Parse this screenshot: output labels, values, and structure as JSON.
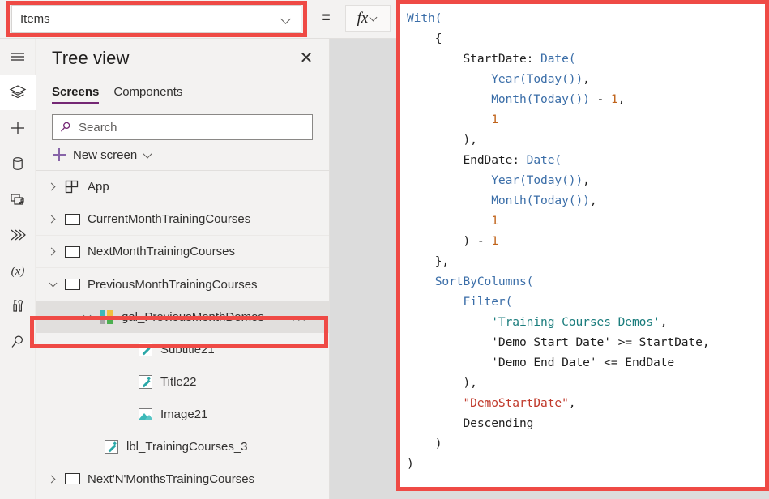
{
  "formula_bar": {
    "property_value": "Items",
    "property_dropdown_icon": "chevron-down-icon",
    "equals_sign": "=",
    "fx_label": "fx",
    "fx_dropdown_icon": "chevron-down-icon"
  },
  "rail": {
    "items": [
      {
        "name": "menu-icon",
        "title": "Menu",
        "selected": false
      },
      {
        "name": "tree-view-icon",
        "title": "Tree view",
        "selected": true
      },
      {
        "name": "insert-icon",
        "title": "Insert",
        "selected": false
      },
      {
        "name": "data-icon",
        "title": "Data",
        "selected": false
      },
      {
        "name": "media-icon",
        "title": "Media",
        "selected": false
      },
      {
        "name": "power-automate-icon",
        "title": "Power Automate",
        "selected": false
      },
      {
        "name": "variables-icon",
        "title": "Variables",
        "selected": false
      },
      {
        "name": "advanced-tools-icon",
        "title": "Advanced tools",
        "selected": false
      },
      {
        "name": "search-icon",
        "title": "Search",
        "selected": false
      }
    ]
  },
  "tree_view": {
    "title": "Tree view",
    "close_icon": "close-icon",
    "tabs": [
      {
        "label": "Screens",
        "active": true
      },
      {
        "label": "Components",
        "active": false
      }
    ],
    "search": {
      "placeholder": "Search",
      "value": "",
      "icon": "search-icon"
    },
    "new_screen": {
      "label": "New screen",
      "plus_icon": "plus-icon",
      "chevron_icon": "chevron-down-icon"
    },
    "rows": [
      {
        "label": "App",
        "icon": "app-icon",
        "indent": 0,
        "caret": "collapsed",
        "selected": false
      },
      {
        "label": "CurrentMonthTrainingCourses",
        "icon": "screen-icon",
        "indent": 0,
        "caret": "collapsed",
        "selected": false
      },
      {
        "label": "NextMonthTrainingCourses",
        "icon": "screen-icon",
        "indent": 0,
        "caret": "collapsed",
        "selected": false
      },
      {
        "label": "PreviousMonthTrainingCourses",
        "icon": "screen-icon",
        "indent": 0,
        "caret": "expanded",
        "selected": false
      },
      {
        "label": "gal_PreviousMonthDemos",
        "icon": "gallery-icon",
        "indent": 1,
        "caret": "expanded",
        "selected": true,
        "overflow": "..."
      },
      {
        "label": "Subtitle21",
        "icon": "label-icon",
        "indent": 2,
        "caret": "none",
        "selected": false
      },
      {
        "label": "Title22",
        "icon": "label-icon",
        "indent": 2,
        "caret": "none",
        "selected": false
      },
      {
        "label": "Image21",
        "icon": "image-icon",
        "indent": 2,
        "caret": "none",
        "selected": false
      },
      {
        "label": "lbl_TrainingCourses_3",
        "icon": "label-icon",
        "indent": 1,
        "caret": "none",
        "selected": false
      },
      {
        "label": "Next'N'MonthsTrainingCourses",
        "icon": "screen-icon",
        "indent": 0,
        "caret": "collapsed",
        "selected": false
      }
    ]
  },
  "code_editor": {
    "language": "Power Fx",
    "lines": [
      [
        {
          "t": "With(",
          "c": "fn"
        }
      ],
      [
        {
          "t": "    {",
          "c": "plain"
        }
      ],
      [
        {
          "t": "        StartDate: ",
          "c": "plain"
        },
        {
          "t": "Date(",
          "c": "fn"
        }
      ],
      [
        {
          "t": "            ",
          "c": "plain"
        },
        {
          "t": "Year(Today())",
          "c": "fn"
        },
        {
          "t": ",",
          "c": "plain"
        }
      ],
      [
        {
          "t": "            ",
          "c": "plain"
        },
        {
          "t": "Month(Today())",
          "c": "fn"
        },
        {
          "t": " - ",
          "c": "plain"
        },
        {
          "t": "1",
          "c": "num"
        },
        {
          "t": ",",
          "c": "plain"
        }
      ],
      [
        {
          "t": "            ",
          "c": "plain"
        },
        {
          "t": "1",
          "c": "num"
        }
      ],
      [
        {
          "t": "        ),",
          "c": "plain"
        }
      ],
      [
        {
          "t": "        EndDate: ",
          "c": "plain"
        },
        {
          "t": "Date(",
          "c": "fn"
        }
      ],
      [
        {
          "t": "            ",
          "c": "plain"
        },
        {
          "t": "Year(Today())",
          "c": "fn"
        },
        {
          "t": ",",
          "c": "plain"
        }
      ],
      [
        {
          "t": "            ",
          "c": "plain"
        },
        {
          "t": "Month(Today())",
          "c": "fn"
        },
        {
          "t": ",",
          "c": "plain"
        }
      ],
      [
        {
          "t": "            ",
          "c": "plain"
        },
        {
          "t": "1",
          "c": "num"
        }
      ],
      [
        {
          "t": "        ) - ",
          "c": "plain"
        },
        {
          "t": "1",
          "c": "num"
        }
      ],
      [
        {
          "t": "    },",
          "c": "plain"
        }
      ],
      [
        {
          "t": "    ",
          "c": "plain"
        },
        {
          "t": "SortByColumns(",
          "c": "fn"
        }
      ],
      [
        {
          "t": "        ",
          "c": "plain"
        },
        {
          "t": "Filter(",
          "c": "fn"
        }
      ],
      [
        {
          "t": "            ",
          "c": "plain"
        },
        {
          "t": "'Training Courses Demos'",
          "c": "tbl"
        },
        {
          "t": ",",
          "c": "plain"
        }
      ],
      [
        {
          "t": "            'Demo Start Date' >= StartDate,",
          "c": "plain"
        }
      ],
      [
        {
          "t": "            'Demo End Date' <= EndDate",
          "c": "plain"
        }
      ],
      [
        {
          "t": "        ),",
          "c": "plain"
        }
      ],
      [
        {
          "t": "        ",
          "c": "plain"
        },
        {
          "t": "\"DemoStartDate\"",
          "c": "str"
        },
        {
          "t": ",",
          "c": "plain"
        }
      ],
      [
        {
          "t": "        Descending",
          "c": "plain"
        }
      ],
      [
        {
          "t": "    )",
          "c": "plain"
        }
      ],
      [
        {
          "t": ")",
          "c": "plain"
        }
      ]
    ]
  },
  "annotations": {
    "highlight_color": "#ef4a45",
    "boxes": [
      {
        "name": "property-dropdown-highlight"
      },
      {
        "name": "gallery-node-highlight"
      },
      {
        "name": "formula-code-highlight"
      }
    ]
  },
  "colors": {
    "accent_purple": "#742774",
    "panel_background": "#f3f2f1",
    "selected_row": "#e1dfdd",
    "gallery_icon_tiles": [
      "#3cb8b8",
      "#f0c040",
      "#a6a6a6",
      "#4caf50"
    ],
    "code_function": "#3b6ea8",
    "code_number": "#c0631a",
    "code_table": "#1b7d7d",
    "code_string": "#c0392b"
  }
}
